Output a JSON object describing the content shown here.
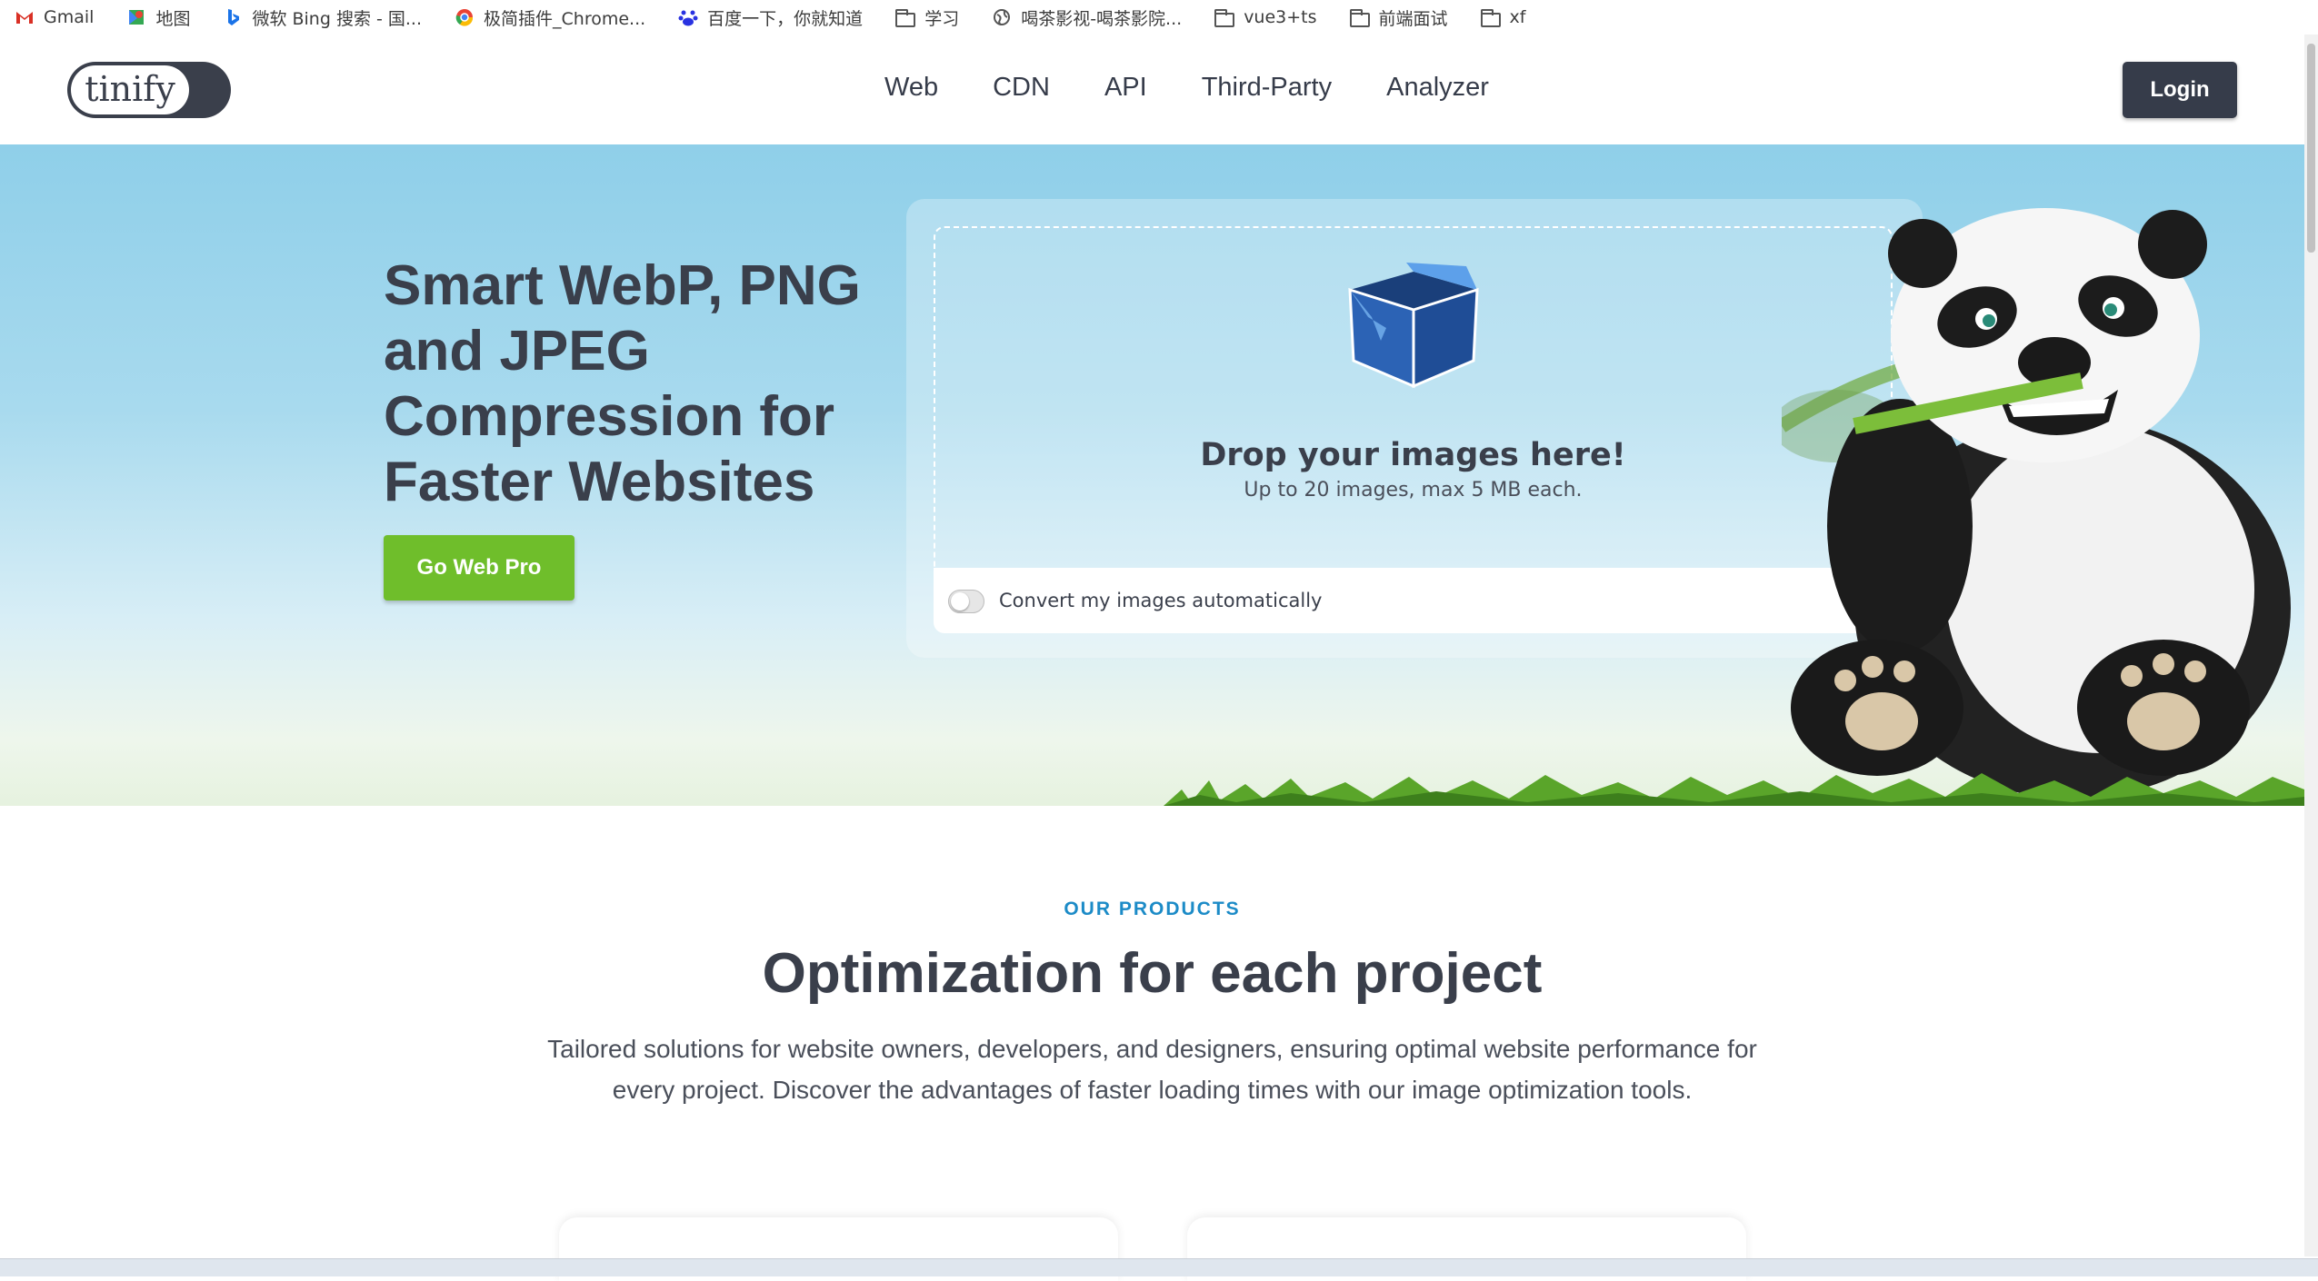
{
  "bookmarks": [
    {
      "icon": "gmail-icon",
      "label": "Gmail"
    },
    {
      "icon": "maps-icon",
      "label": "地图"
    },
    {
      "icon": "bing-icon",
      "label": "微软 Bing 搜索 - 国..."
    },
    {
      "icon": "chrome-icon",
      "label": "极简插件_Chrome..."
    },
    {
      "icon": "baidu-icon",
      "label": "百度一下，你就知道"
    },
    {
      "icon": "folder-icon",
      "label": "学习"
    },
    {
      "icon": "globe-icon",
      "label": "喝茶影视-喝茶影院..."
    },
    {
      "icon": "folder-icon",
      "label": "vue3+ts"
    },
    {
      "icon": "folder-icon",
      "label": "前端面试"
    },
    {
      "icon": "folder-icon",
      "label": "xf"
    }
  ],
  "header": {
    "logo_text": "tinify",
    "nav": [
      "Web",
      "CDN",
      "API",
      "Third-Party",
      "Analyzer"
    ],
    "login_label": "Login"
  },
  "hero": {
    "title": "Smart WebP, PNG and JPEG Compression for Faster Websites",
    "cta_label": "Go Web Pro",
    "drop_title": "Drop your images here!",
    "drop_subtitle": "Up to 20 images, max 5 MB each.",
    "convert_label": "Convert my images automatically"
  },
  "products": {
    "eyebrow": "OUR PRODUCTS",
    "title": "Optimization for each project",
    "description": "Tailored solutions for website owners, developers, and designers, ensuring optimal website performance for every project. Discover the advantages of faster loading times with our image optimization tools."
  },
  "colors": {
    "brand_dark": "#363c4a",
    "cta_green": "#6fbe2b",
    "eyebrow_blue": "#1c8bc7",
    "hero_sky": "#8fcfe9"
  }
}
